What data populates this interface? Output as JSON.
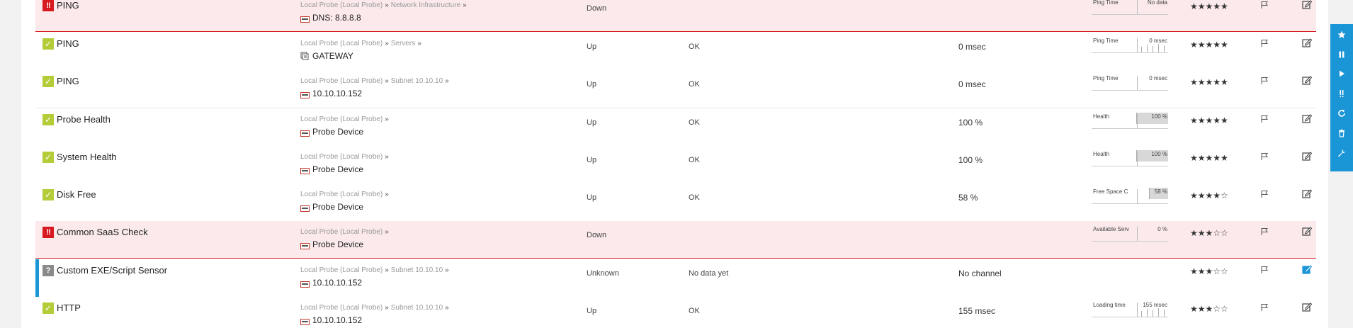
{
  "rows": [
    {
      "status": "down",
      "status_icon": "error-icon",
      "name": "PING",
      "breadcrumb": [
        "Local Probe (Local Probe)",
        "Network Infrastructure"
      ],
      "device_icon": "device-icon",
      "device": "DNS: 8.8.8.8",
      "status_text": "Down",
      "message": "",
      "last_value": "",
      "graph": {
        "label": "Ping Time",
        "value": "No data",
        "fill": 0
      },
      "stars": 5,
      "edit_icon": "edit-icon"
    },
    {
      "status": "up",
      "status_icon": "check-icon",
      "name": "PING",
      "breadcrumb": [
        "Local Probe (Local Probe)",
        "Servers"
      ],
      "device_icon": "server-icon",
      "device": "GATEWAY",
      "status_text": "Up",
      "message": "OK",
      "last_value": "0 msec",
      "graph": {
        "label": "Ping Time",
        "value": "0 msec",
        "fill": 0
      },
      "stars": 5,
      "edit_icon": "edit-icon"
    },
    {
      "status": "up",
      "status_icon": "check-icon",
      "name": "PING",
      "breadcrumb": [
        "Local Probe (Local Probe)",
        "Subnet 10.10.10"
      ],
      "device_icon": "device-icon",
      "device": "10.10.10.152",
      "status_text": "Up",
      "message": "OK",
      "last_value": "0 msec",
      "graph": {
        "label": "Ping Time",
        "value": "0 msec",
        "fill": 0
      },
      "stars": 5,
      "edit_icon": "edit-icon"
    },
    {
      "status": "up",
      "status_icon": "check-icon",
      "name": "Probe Health",
      "breadcrumb": [
        "Local Probe (Local Probe)"
      ],
      "device_icon": "device-icon",
      "device": "Probe Device",
      "status_text": "Up",
      "message": "OK",
      "last_value": "100 %",
      "graph": {
        "label": "Health",
        "value": "100 %",
        "fill": 1.0
      },
      "stars": 5,
      "edit_icon": "edit-icon"
    },
    {
      "status": "up",
      "status_icon": "check-icon",
      "name": "System Health",
      "breadcrumb": [
        "Local Probe (Local Probe)"
      ],
      "device_icon": "device-icon",
      "device": "Probe Device",
      "status_text": "Up",
      "message": "OK",
      "last_value": "100 %",
      "graph": {
        "label": "Health",
        "value": "100 %",
        "fill": 1.0
      },
      "stars": 5,
      "edit_icon": "edit-icon"
    },
    {
      "status": "up",
      "status_icon": "check-icon",
      "name": "Disk Free",
      "breadcrumb": [
        "Local Probe (Local Probe)"
      ],
      "device_icon": "device-icon",
      "device": "Probe Device",
      "status_text": "Up",
      "message": "OK",
      "last_value": "58 %",
      "graph": {
        "label": "Free Space C",
        "value": "58 %",
        "fill": 0.58
      },
      "stars": 4,
      "edit_icon": "edit-icon"
    },
    {
      "status": "down",
      "status_icon": "error-icon",
      "name": "Common SaaS Check",
      "breadcrumb": [
        "Local Probe (Local Probe)"
      ],
      "device_icon": "device-icon",
      "device": "Probe Device",
      "status_text": "Down",
      "message": "",
      "last_value": "",
      "graph": {
        "label": "Available Serv",
        "value": "0 %",
        "fill": 0
      },
      "stars": 3,
      "edit_icon": "edit-icon"
    },
    {
      "status": "unknown",
      "status_icon": "unknown-icon",
      "name": "Custom EXE/Script Sensor",
      "breadcrumb": [
        "Local Probe (Local Probe)",
        "Subnet 10.10.10"
      ],
      "device_icon": "device-icon",
      "device": "10.10.10.152",
      "status_text": "Unknown",
      "message": "No data yet",
      "last_value": "No channel",
      "graph": null,
      "stars": 3,
      "edit_icon": "edit-icon-active"
    },
    {
      "status": "up",
      "status_icon": "check-icon",
      "name": "HTTP",
      "breadcrumb": [
        "Local Probe (Local Probe)",
        "Subnet 10.10.10"
      ],
      "device_icon": "device-icon",
      "device": "10.10.10.152",
      "status_text": "Up",
      "message": "OK",
      "last_value": "155 msec",
      "graph": {
        "label": "Loading time",
        "value": "155 msec",
        "fill": 0
      },
      "stars": 3,
      "edit_icon": "edit-icon"
    }
  ],
  "breadcrumb_separator": "»",
  "toolbar": [
    {
      "icon": "star-icon"
    },
    {
      "icon": "pause-icon"
    },
    {
      "icon": "play-icon"
    },
    {
      "icon": "acknowledge-icon"
    },
    {
      "icon": "refresh-icon"
    },
    {
      "icon": "trash-icon"
    },
    {
      "icon": "wrench-icon"
    }
  ],
  "colors": {
    "up": "#b4cc38",
    "down": "#d71920",
    "unknown": "#8a8a8a",
    "accent": "#1a95d6",
    "down_row_bg": "#fbe9eb"
  }
}
